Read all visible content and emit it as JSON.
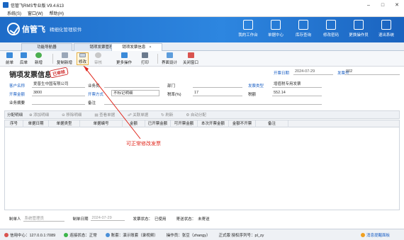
{
  "window": {
    "title": "信管飞RMS专业版 V9.4.613"
  },
  "menu": [
    "系统(S)",
    "窗口(W)",
    "帮助(H)"
  ],
  "banner": {
    "brand": "信管飞",
    "slogan": "精细化管理软件"
  },
  "nav": [
    {
      "label": "我的工作台",
      "icon": "desk-icon"
    },
    {
      "label": "单据中心",
      "icon": "document-icon"
    },
    {
      "label": "库存查询",
      "icon": "inventory-icon"
    },
    {
      "label": "修改密码",
      "icon": "password-icon"
    },
    {
      "label": "更换操作员",
      "icon": "switch-user-icon"
    },
    {
      "label": "退出系统",
      "icon": "exit-icon"
    }
  ],
  "tabs": [
    {
      "label": "功能导航器"
    },
    {
      "label": "销项发票管理"
    },
    {
      "label": "销项发票信息",
      "active": true
    }
  ],
  "toolbar": [
    {
      "label": "前单",
      "enabled": true
    },
    {
      "label": "后单",
      "enabled": true
    },
    {
      "label": "新增",
      "enabled": true,
      "dropdown": true
    },
    {
      "label": "复制新增",
      "enabled": true
    },
    {
      "label": "修改",
      "enabled": true,
      "highlighted": true
    },
    {
      "label": "审核",
      "enabled": false,
      "dropdown": true
    },
    {
      "label": "更多操作",
      "enabled": true,
      "dropdown": true
    },
    {
      "label": "打印",
      "enabled": true,
      "dropdown": true
    },
    {
      "label": "界面设计",
      "enabled": true
    },
    {
      "label": "关闭窗口",
      "enabled": true
    }
  ],
  "form": {
    "title": "销项发票信息",
    "stamp": "已审核",
    "open_date_label": "开票日期",
    "open_date": "2024-07-29",
    "invoice_no_label": "发票号",
    "invoice_no": "002",
    "customer_label": "客户名称",
    "customer": "爱普生中国有限公司",
    "salesman_label": "业务员",
    "salesman": "",
    "dept_label": "部门",
    "dept": "",
    "invoice_type_label": "发票类型",
    "invoice_type": "增值税专用发票",
    "amount_label": "开票金额",
    "amount": "3800",
    "method_label": "开票方式",
    "method": "不标记明细",
    "tax_rate_label": "税率(%)",
    "tax_rate": "17",
    "tax_label": "税额",
    "tax": "552.14",
    "summary_label": "业务摘要",
    "summary": "",
    "note_label": "备注",
    "note": ""
  },
  "detail_toolbar": [
    "分配明细",
    "添加明细",
    "移除明细",
    "查看单据",
    "关联单据",
    "刷新",
    "自动分配"
  ],
  "grid_columns": [
    "序号",
    "单据日期",
    "单据类型",
    "单据编号",
    "金额",
    "已开票金额",
    "可开票金额",
    "本次开票金额",
    "金额不开票",
    "备注"
  ],
  "annotation": "可正常修改发票",
  "footer": {
    "maker_label": "制单人",
    "maker": "系统管理员",
    "make_date_label": "制单日期",
    "make_date": "2024-07-29",
    "invoice_status_label": "发票状态：",
    "invoice_status": "已使用",
    "send_status_label": "寄送状态：",
    "send_status": "未寄送"
  },
  "status": {
    "server": "信用中心：127.0.0.1:7089",
    "connection": "连接状态：正常",
    "account": "账套：演示账套（录视频）",
    "operator": "操作员：张豆（zhangy）",
    "license": "正式版 授权序列号：pl_zy",
    "message": "消息提醒面板"
  }
}
